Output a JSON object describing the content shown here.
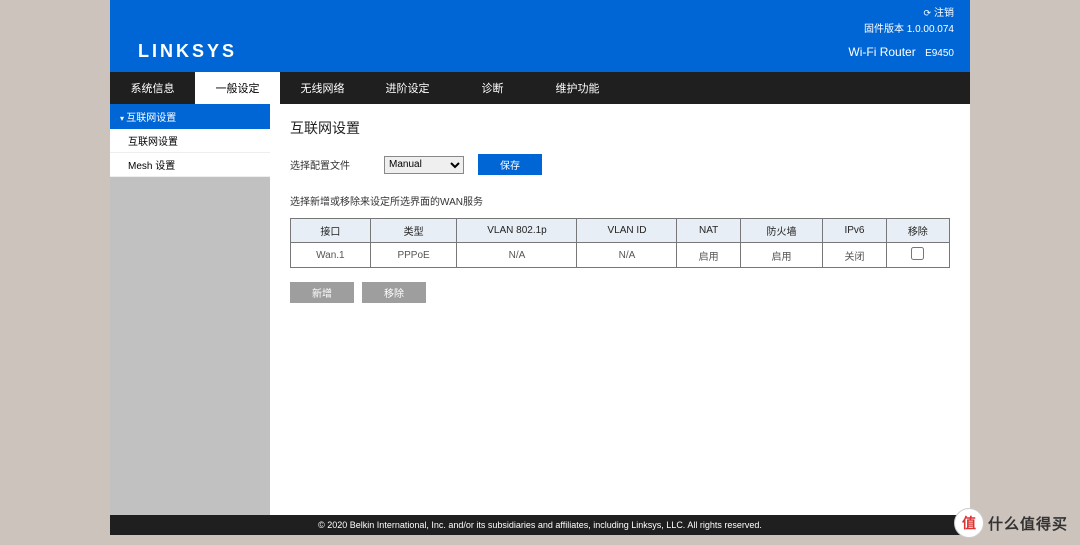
{
  "topbar": {
    "logout": "注销",
    "firmware": "固件版本 1.0.00.074",
    "product_name": "Wi-Fi Router",
    "product_model": "E9450"
  },
  "logo": "LINKSYS",
  "nav": [
    "系统信息",
    "一般设定",
    "无线网络",
    "进阶设定",
    "诊断",
    "维护功能"
  ],
  "nav_active": 1,
  "sidebar": {
    "head": "互联网设置",
    "items": [
      "互联网设置",
      "Mesh 设置"
    ]
  },
  "page": {
    "title": "互联网设置",
    "config_label": "选择配置文件",
    "profile_selected": "Manual",
    "save_label": "保存",
    "instruction": "选择新增或移除来设定所选界面的WAN服务"
  },
  "table": {
    "headers": [
      "接口",
      "类型",
      "VLAN 802.1p",
      "VLAN ID",
      "NAT",
      "防火墙",
      "IPv6",
      "移除"
    ],
    "rows": [
      {
        "iface": "Wan.1",
        "type": "PPPoE",
        "vlan_p": "N/A",
        "vlan_id": "N/A",
        "nat": "启用",
        "fw": "启用",
        "ipv6": "关闭",
        "remove": false
      }
    ]
  },
  "actions": {
    "add": "新增",
    "remove": "移除"
  },
  "footer": "© 2020 Belkin International, Inc. and/or its subsidiaries and affiliates, including Linksys, LLC. All rights reserved.",
  "watermark": "什么值得买"
}
